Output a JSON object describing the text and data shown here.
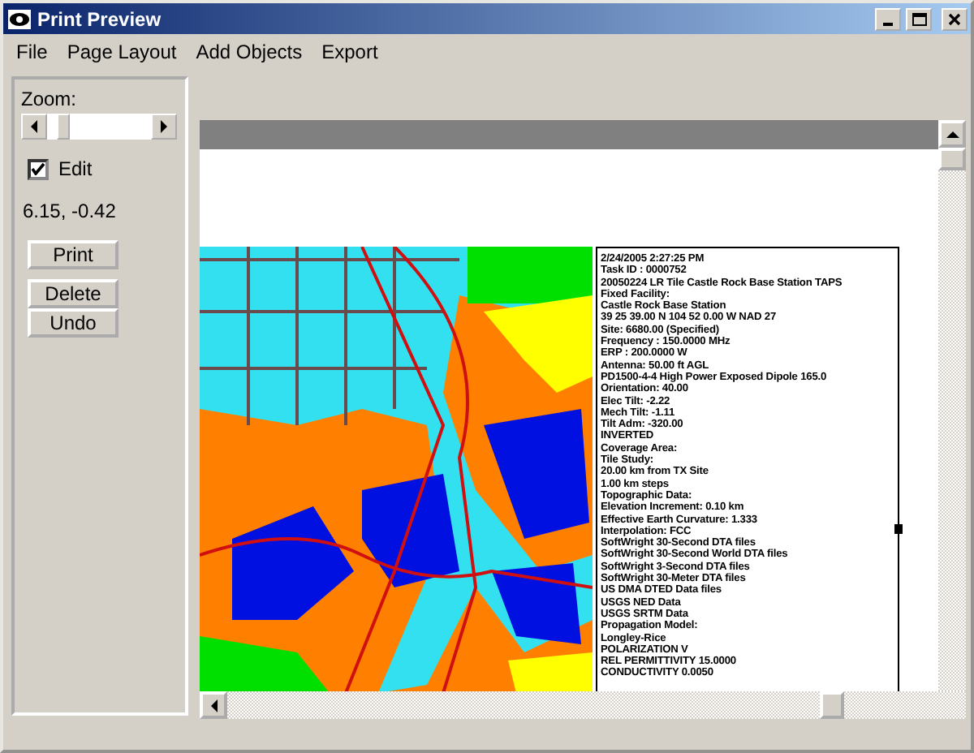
{
  "window": {
    "title": "Print Preview"
  },
  "menu": [
    {
      "label": "File"
    },
    {
      "label": "Page Layout"
    },
    {
      "label": "Add Objects"
    },
    {
      "label": "Export"
    }
  ],
  "panel": {
    "zoom_label": "Zoom:",
    "zoom_slider": {
      "level": 0.12
    },
    "edit": {
      "label": "Edit",
      "checked": true
    },
    "coordinates": "6.15, -0.42",
    "buttons": [
      "Print",
      "Delete",
      "Undo"
    ]
  },
  "preview": {
    "info_lines": [
      "2/24/2005 2:27:25 PM",
      "Task ID : 0000752",
      "20050224 LR Tile Castle Rock Base Station TAPS",
      "Fixed Facility:",
      "Castle Rock Base Station",
      "39 25 39.00 N 104 52 0.00 W NAD 27",
      "Site: 6680.00 (Specified)",
      "Frequency : 150.0000 MHz",
      "ERP : 200.0000 W",
      "Antenna: 50.00 ft AGL",
      "PD1500-4-4 High Power Exposed Dipole 165.0",
      "Orientation: 40.00",
      "Elec Tilt: -2.22",
      "Mech Tilt: -1.11",
      "Tilt Adm: -320.00",
      "INVERTED",
      "Coverage Area:",
      "Tile Study:",
      "20.00 km from TX Site",
      "1.00 km steps",
      "Topographic Data:",
      "Elevation Increment: 0.10 km",
      "Effective Earth Curvature: 1.333",
      "Interpolation: FCC",
      "SoftWright 30-Second DTA files",
      "SoftWright 30-Second World DTA files",
      "SoftWright 3-Second DTA files",
      "SoftWright 30-Meter DTA files",
      "US DMA DTED Data files",
      "USGS NED Data",
      "USGS SRTM Data",
      "Propagation Model:",
      "Longley-Rice",
      "POLARIZATION V",
      "REL PERMITTIVITY 15.0000",
      "CONDUCTIVITY 0.0050"
    ]
  }
}
